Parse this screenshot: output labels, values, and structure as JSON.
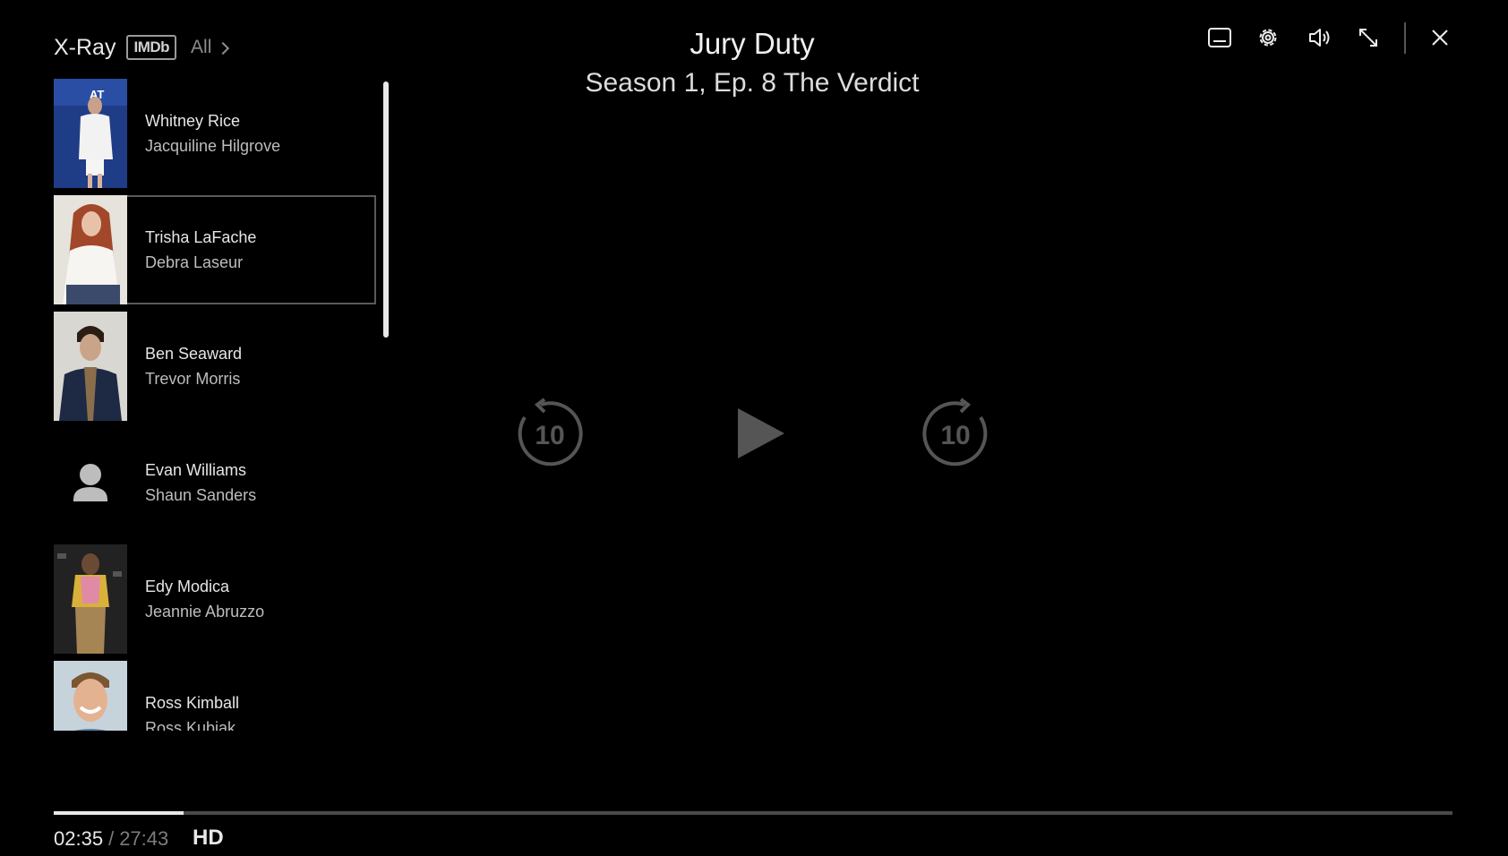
{
  "xray": {
    "title": "X-Ray",
    "badge": "IMDb",
    "filter_label": "All"
  },
  "player": {
    "show_title": "Jury Duty",
    "episode_title": "Season 1, Ep. 8 The Verdict",
    "current_time": "02:35",
    "separator": "/",
    "total_time": "27:43",
    "quality": "HD",
    "progress_fraction": 0.093,
    "skip_back_label": "10",
    "skip_forward_label": "10"
  },
  "cast": [
    {
      "name": "Whitney Rice",
      "role": "Jacquiline Hilgrove",
      "photo": "portrait-white-dress",
      "selected": false
    },
    {
      "name": "Trisha LaFache",
      "role": "Debra Laseur",
      "photo": "portrait-red-hair",
      "selected": true
    },
    {
      "name": "Ben Seaward",
      "role": "Trevor Morris",
      "photo": "portrait-navy-suit",
      "selected": false
    },
    {
      "name": "Evan Williams",
      "role": "Shaun Sanders",
      "photo": "person-placeholder-icon",
      "selected": false
    },
    {
      "name": "Edy Modica",
      "role": "Jeannie Abruzzo",
      "photo": "portrait-yellow-jacket",
      "selected": false
    },
    {
      "name": "Ross Kimball",
      "role": "Ross Kubiak",
      "photo": "portrait-smiling",
      "selected": false
    }
  ],
  "icons": [
    "subtitles-icon",
    "settings-icon",
    "volume-icon",
    "exit-fullscreen-icon",
    "close-icon",
    "replay-10-icon",
    "play-icon",
    "forward-10-icon"
  ],
  "colors": {
    "background": "#000000",
    "icon": "#ececec",
    "playback_icon": "#555555",
    "progress_fill": "#e8e8e8"
  }
}
